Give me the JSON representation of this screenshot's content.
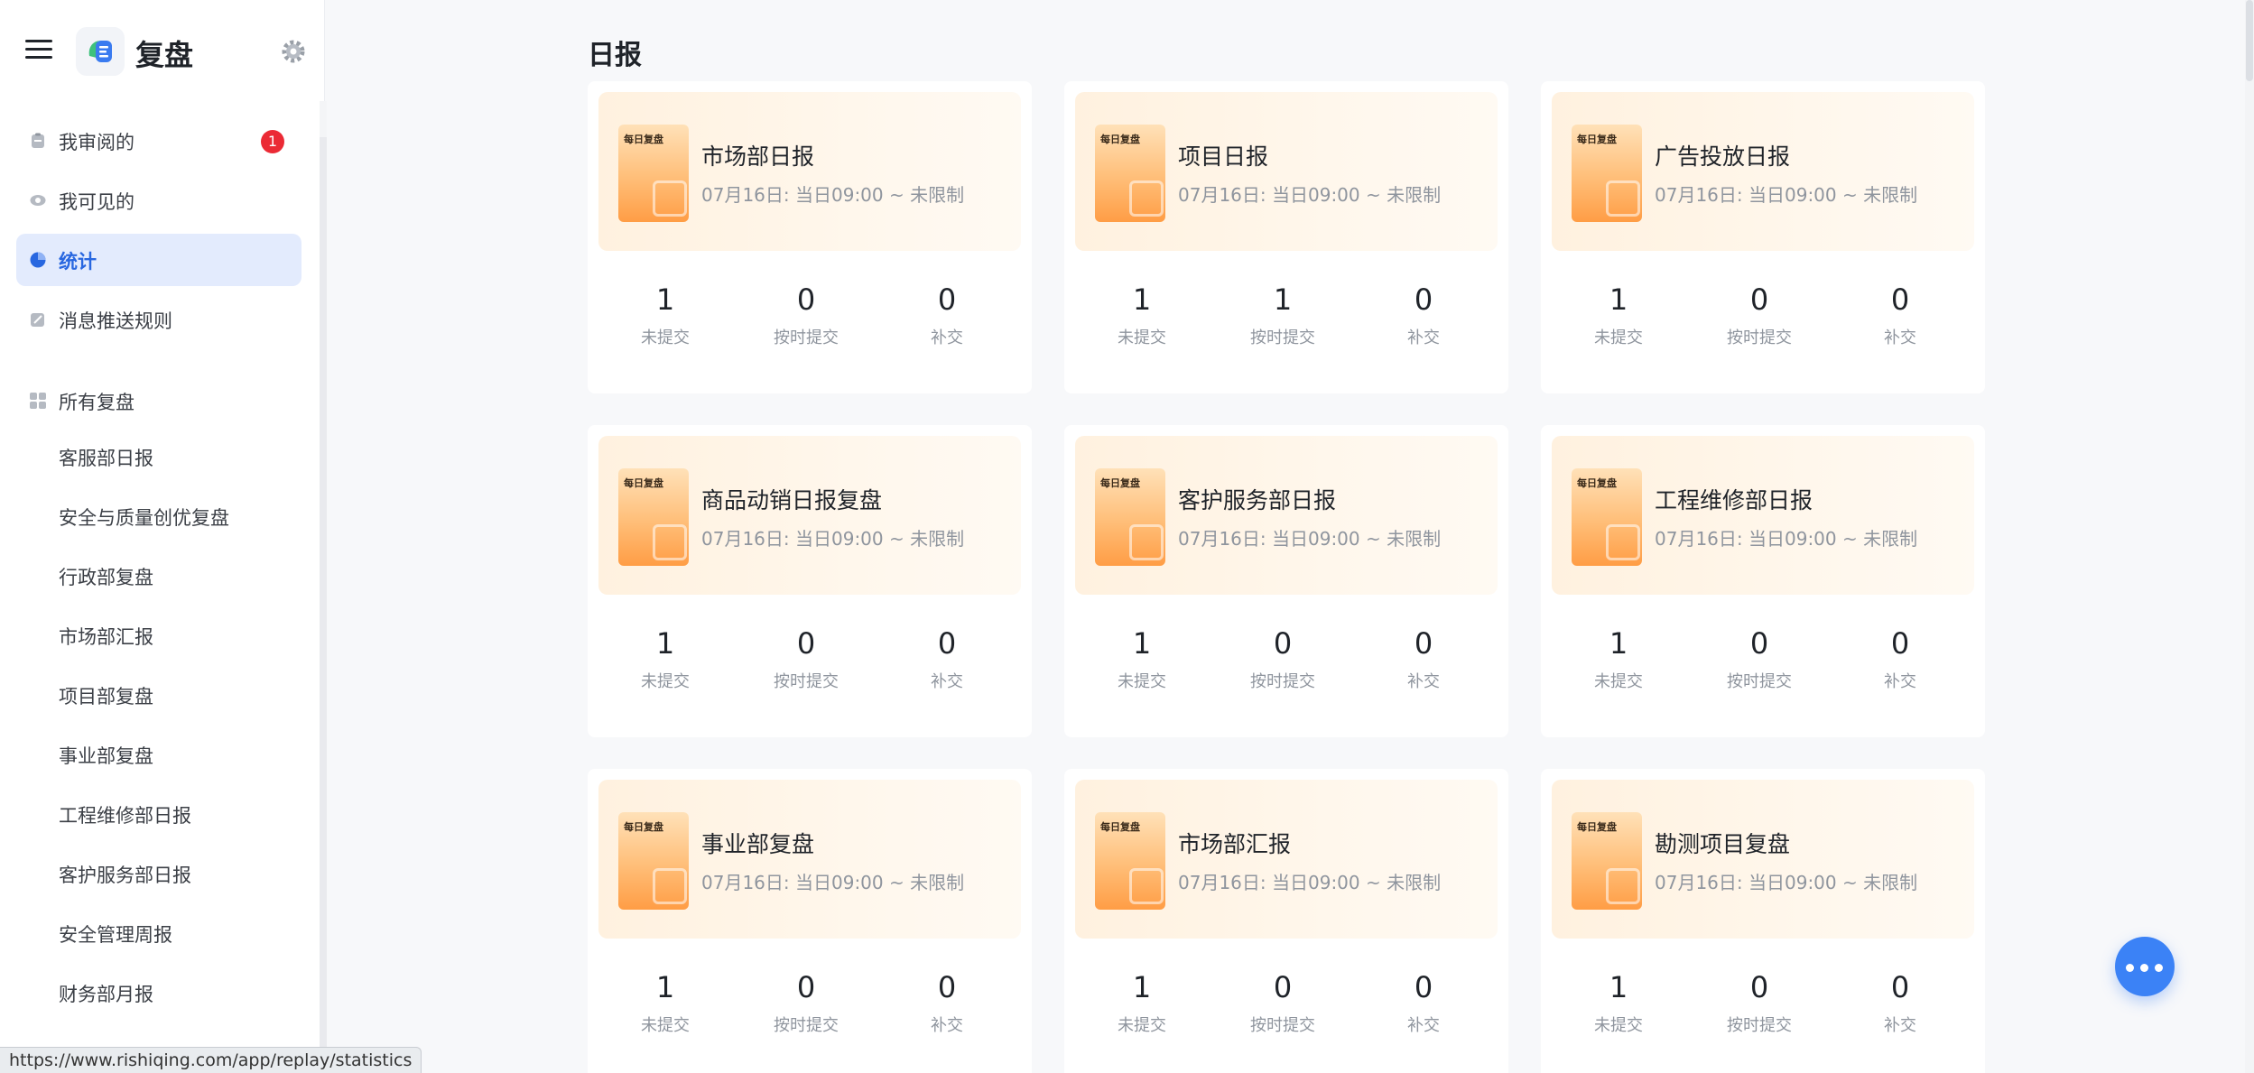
{
  "app": {
    "title": "复盘"
  },
  "nav": {
    "primary": [
      {
        "label": "我审阅的",
        "badge": "1",
        "icon": "clipboard-icon"
      },
      {
        "label": "我可见的",
        "icon": "eye-icon"
      },
      {
        "label": "统计",
        "icon": "pie-chart-icon",
        "active": true
      },
      {
        "label": "消息推送规则",
        "icon": "edit-icon"
      }
    ],
    "all_label": "所有复盘",
    "reviews": [
      {
        "label": "客服部日报",
        "color": "#f59e42"
      },
      {
        "label": "安全与质量创优复盘",
        "color": "#4bb8e0"
      },
      {
        "label": "行政部复盘",
        "color": "#4bb8e0"
      },
      {
        "label": "市场部汇报",
        "color": "#f59e42"
      },
      {
        "label": "项目部复盘",
        "color": "#b36ae2"
      },
      {
        "label": "事业部复盘",
        "color": "#f59e42"
      },
      {
        "label": "工程维修部日报",
        "color": "#f59e42"
      },
      {
        "label": "客护服务部日报",
        "color": "#f59e42"
      },
      {
        "label": "安全管理周报",
        "color": "#4bb8e0"
      },
      {
        "label": "财务部月报",
        "color": "#b36ae2"
      }
    ]
  },
  "status_url": "https://www.rishiqing.com/app/replay/statistics",
  "page": {
    "title": "日报"
  },
  "thumb_label": "每日复盘",
  "stat_labels": [
    "未提交",
    "按时提交",
    "补交"
  ],
  "cards": [
    {
      "title": "市场部日报",
      "subtitle": "07月16日: 当日09:00 ~ 未限制",
      "stats": [
        "1",
        "0",
        "0"
      ]
    },
    {
      "title": "项目日报",
      "subtitle": "07月16日: 当日09:00 ~ 未限制",
      "stats": [
        "1",
        "1",
        "0"
      ]
    },
    {
      "title": "广告投放日报",
      "subtitle": "07月16日: 当日09:00 ~ 未限制",
      "stats": [
        "1",
        "0",
        "0"
      ]
    },
    {
      "title": "商品动销日报复盘",
      "subtitle": "07月16日: 当日09:00 ~ 未限制",
      "stats": [
        "1",
        "0",
        "0"
      ]
    },
    {
      "title": "客护服务部日报",
      "subtitle": "07月16日: 当日09:00 ~ 未限制",
      "stats": [
        "1",
        "0",
        "0"
      ]
    },
    {
      "title": "工程维修部日报",
      "subtitle": "07月16日: 当日09:00 ~ 未限制",
      "stats": [
        "1",
        "0",
        "0"
      ]
    },
    {
      "title": "事业部复盘",
      "subtitle": "07月16日: 当日09:00 ~ 未限制",
      "stats": [
        "1",
        "0",
        "0"
      ]
    },
    {
      "title": "市场部汇报",
      "subtitle": "07月16日: 当日09:00 ~ 未限制",
      "stats": [
        "1",
        "0",
        "0"
      ]
    },
    {
      "title": "勘测项目复盘",
      "subtitle": "07月16日: 当日09:00 ~ 未限制",
      "stats": [
        "1",
        "0",
        "0"
      ]
    }
  ],
  "colors": {
    "accent": "#2867e0",
    "badge": "#eb2a35",
    "fab": "#3b82f6"
  }
}
